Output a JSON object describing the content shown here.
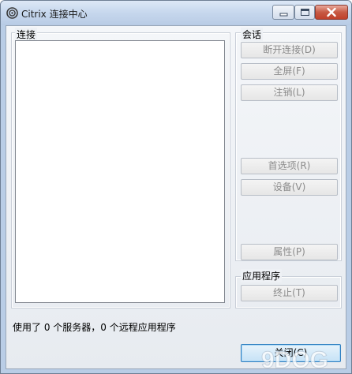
{
  "window": {
    "title": "Citrix 连接中心",
    "icon": "citrix-spiral-icon"
  },
  "groups": {
    "connections_label": "连接",
    "session_label": "会话",
    "applications_label": "应用程序"
  },
  "session_buttons": {
    "disconnect": "断开连接(D)",
    "fullscreen": "全屏(F)",
    "logoff": "注销(L)",
    "preferences": "首选项(R)",
    "devices": "设备(V)",
    "properties": "属性(P)"
  },
  "app_buttons": {
    "terminate": "终止(T)"
  },
  "status_text": "使用了 0 个服务器，0 个远程应用程序",
  "footer": {
    "close_label": "关闭(C)"
  },
  "watermark": "9DOG"
}
